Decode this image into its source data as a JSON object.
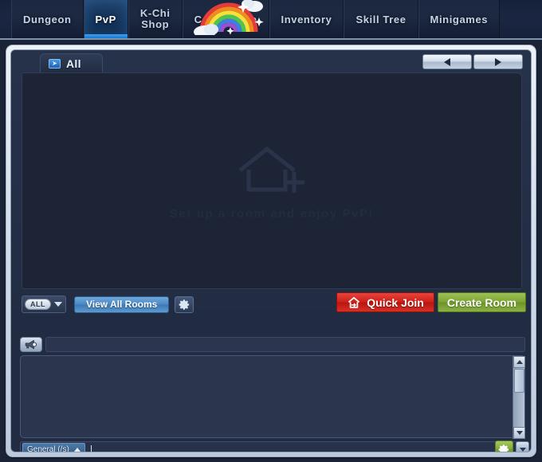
{
  "nav": {
    "tabs": [
      {
        "label": "Dungeon",
        "name": "nav-tab-dungeon",
        "active": false
      },
      {
        "label": "PvP",
        "name": "nav-tab-pvp",
        "active": true
      },
      {
        "label": "K-Chi",
        "label2": "Shop",
        "name": "nav-tab-kchi-shop",
        "active": false
      },
      {
        "label": "Coordishop",
        "name": "nav-tab-coordishop",
        "active": false
      },
      {
        "label": "Inventory",
        "name": "nav-tab-inventory",
        "active": false
      },
      {
        "label": "Skill Tree",
        "name": "nav-tab-skill-tree",
        "active": false
      },
      {
        "label": "Minigames",
        "name": "nav-tab-minigames",
        "active": false
      }
    ],
    "decoration": "rainbow-icon"
  },
  "room_panel": {
    "category_tab": {
      "label": "All",
      "icon": "arrow-chip-icon"
    },
    "pager": {
      "prev_icon": "triangle-left-icon",
      "next_icon": "triangle-right-icon"
    },
    "empty_state": {
      "icon": "house-plus-icon",
      "message": "Set up a room and enjoy PvP!"
    },
    "rooms": []
  },
  "toolbar": {
    "filter_label": "ALL",
    "filter_caret_icon": "caret-down-icon",
    "view_all_rooms_label": "View All Rooms",
    "settings_icon": "gear-icon",
    "quick_join_label": "Quick Join",
    "quick_join_icon": "house-arrow-icon",
    "create_room_label": "Create Room"
  },
  "announcement": {
    "icon": "megaphone-icon",
    "text": ""
  },
  "chat": {
    "messages": [],
    "channel_label": "General (/s)",
    "channel_caret_icon": "caret-up-icon",
    "input_value": "",
    "settings_icon": "gear-icon",
    "scroll_down_icon": "triangle-down-icon",
    "scrollbar": {
      "up_icon": "triangle-up-icon",
      "down_icon": "triangle-down-icon"
    }
  },
  "colors": {
    "accent_blue": "#3ea2ef",
    "quick_join_red": "#cc2018",
    "create_room_green": "#7ca534",
    "panel_dark": "#1c2436",
    "frame_light": "#d2dceb"
  }
}
